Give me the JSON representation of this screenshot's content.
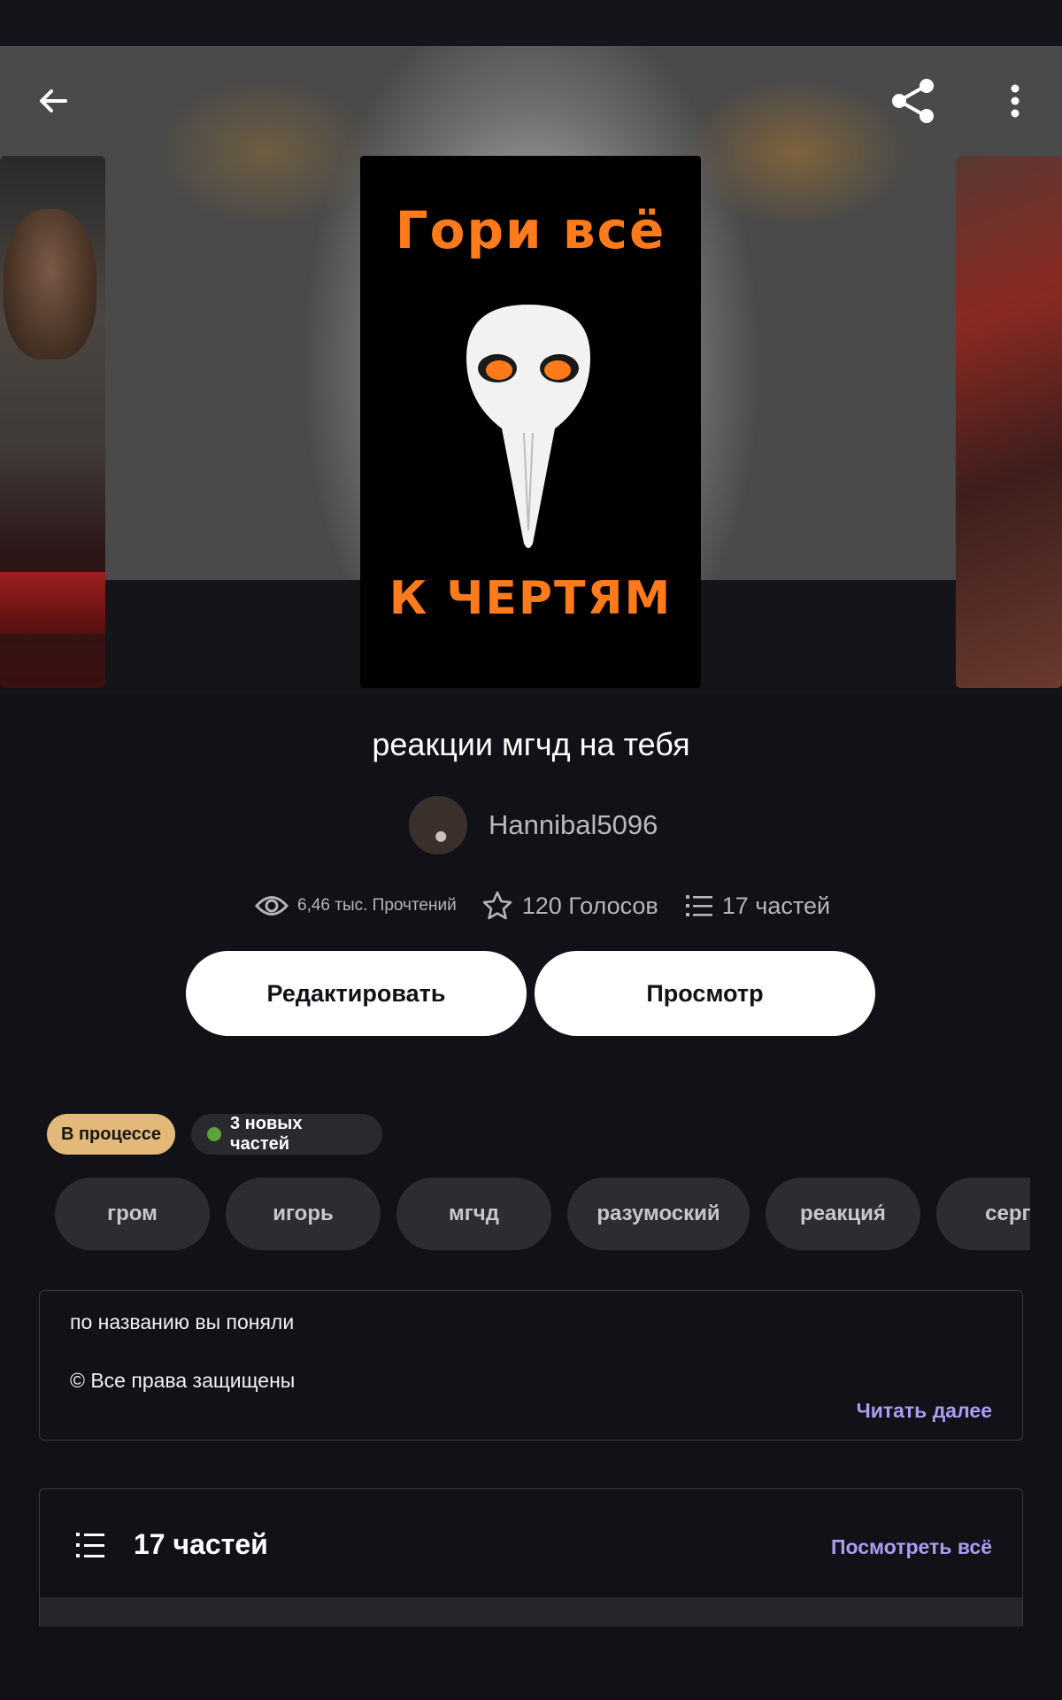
{
  "app": {
    "accent_color": "#a99cf2"
  },
  "header": {
    "back_icon": "arrow-left-icon",
    "share_icon": "share-icon",
    "more_icon": "more-vertical-icon"
  },
  "cover": {
    "line1": "Гори всё",
    "line2": "К ЧЕРТЯМ"
  },
  "story": {
    "title": "реакции мгчд на тебя",
    "author": "Hannibal5096"
  },
  "stats": {
    "reads": "6,46 тыс. Прочтений",
    "votes": "120 Голосов",
    "parts": "17 частей"
  },
  "actions": {
    "edit_label": "Редактировать",
    "preview_label": "Просмотр"
  },
  "badges": {
    "status": "В процессе",
    "new_parts": "3 новых частей",
    "status_color": "#e2b978",
    "new_dot_color": "#5fa23a"
  },
  "tags": [
    "гром",
    "игорь",
    "мгчд",
    "разумоский",
    "реакция́",
    "серге"
  ],
  "description": {
    "line1": "по названию вы поняли",
    "line2": "© Все права защищены",
    "read_more": "Читать далее"
  },
  "parts_section": {
    "title": "17 частей",
    "see_all": "Посмотреть всё"
  }
}
